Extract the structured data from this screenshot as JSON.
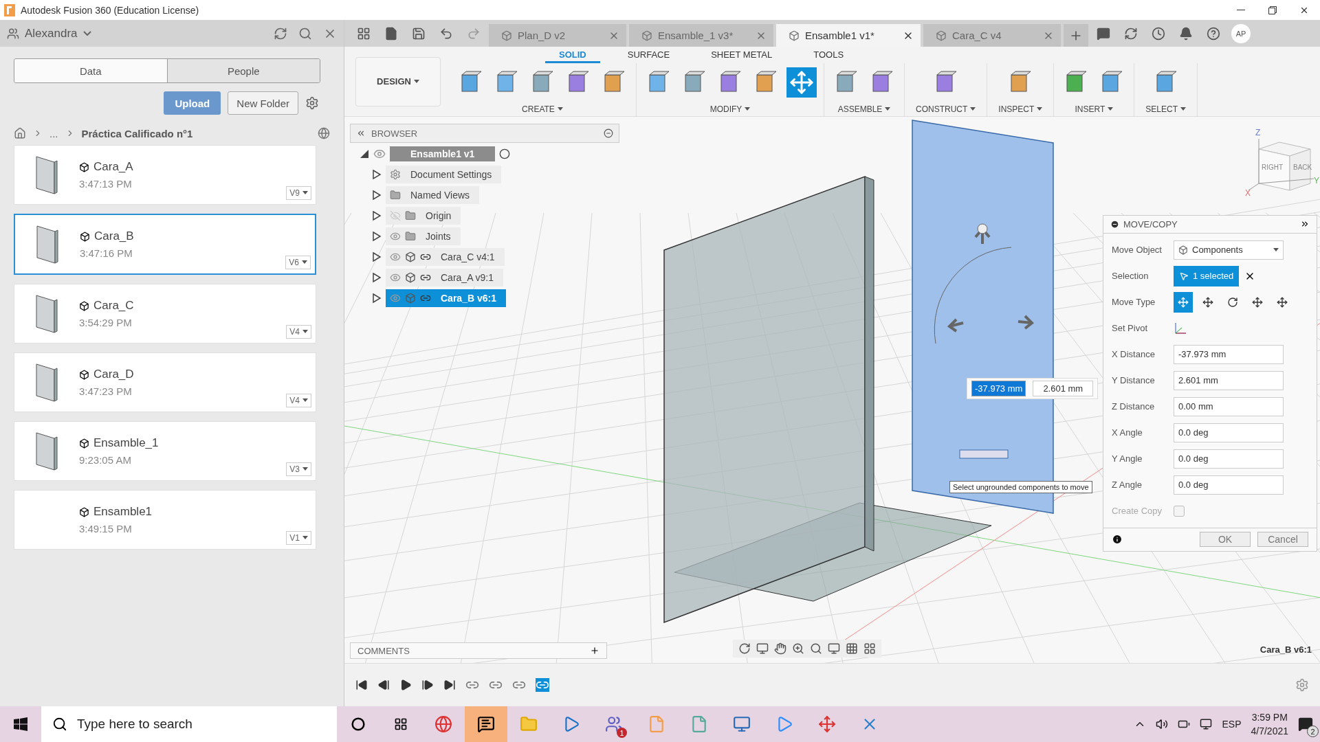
{
  "window": {
    "title": "Autodesk Fusion 360 (Education License)"
  },
  "data_panel": {
    "user": "Alexandra",
    "tabs": [
      {
        "label": "Data",
        "selected": true
      },
      {
        "label": "People",
        "selected": false
      }
    ],
    "upload": "Upload",
    "new_folder": "New Folder",
    "breadcrumb": [
      "...",
      "Práctica Calificado n°1"
    ],
    "files": [
      {
        "name": "Cara_A",
        "time": "3:47:13 PM",
        "version": "V9",
        "selected": false,
        "has_thumbnail": true
      },
      {
        "name": "Cara_B",
        "time": "3:47:16 PM",
        "version": "V6",
        "selected": true,
        "has_thumbnail": true
      },
      {
        "name": "Cara_C",
        "time": "3:54:29 PM",
        "version": "V4",
        "selected": false,
        "has_thumbnail": true
      },
      {
        "name": "Cara_D",
        "time": "3:47:23 PM",
        "version": "V4",
        "selected": false,
        "has_thumbnail": true
      },
      {
        "name": "Ensamble_1",
        "time": "9:23:05 AM",
        "version": "V3",
        "selected": false,
        "has_thumbnail": true
      },
      {
        "name": "Ensamble1",
        "time": "3:49:15 PM",
        "version": "V1",
        "selected": false,
        "has_thumbnail": false
      }
    ]
  },
  "doc_tabs": [
    {
      "label": "Plan_D v2",
      "selected": false
    },
    {
      "label": "Ensamble_1 v3*",
      "selected": false
    },
    {
      "label": "Ensamble1 v1*",
      "selected": true
    },
    {
      "label": "Cara_C v4",
      "selected": false
    }
  ],
  "user_initials": "AP",
  "ribbon": {
    "workspace": "DESIGN",
    "tabs": [
      {
        "label": "SOLID",
        "selected": true
      },
      {
        "label": "SURFACE",
        "selected": false
      },
      {
        "label": "SHEET METAL",
        "selected": false
      },
      {
        "label": "TOOLS",
        "selected": false
      }
    ],
    "groups": [
      {
        "label": "CREATE",
        "tools": [
          {
            "active": false
          },
          {
            "active": false
          },
          {
            "active": false
          },
          {
            "active": false
          },
          {
            "active": false
          }
        ]
      },
      {
        "label": "MODIFY",
        "tools": [
          {
            "active": false
          },
          {
            "active": false
          },
          {
            "active": false
          },
          {
            "active": false
          },
          {
            "active": true
          }
        ]
      },
      {
        "label": "ASSEMBLE",
        "tools": [
          {
            "active": false
          },
          {
            "active": false
          }
        ]
      },
      {
        "label": "CONSTRUCT",
        "tools": [
          {
            "active": false
          }
        ]
      },
      {
        "label": "INSPECT",
        "tools": [
          {
            "active": false
          }
        ]
      },
      {
        "label": "INSERT",
        "tools": [
          {
            "active": false
          },
          {
            "active": false
          }
        ]
      },
      {
        "label": "SELECT",
        "tools": [
          {
            "active": false
          }
        ]
      }
    ]
  },
  "browser": {
    "title": "BROWSER",
    "root": {
      "label": "Ensamble1 v1",
      "expanded": true,
      "children": [
        {
          "label": "Document Settings",
          "kind": "settings",
          "expanded": false,
          "selected": false
        },
        {
          "label": "Named Views",
          "kind": "folder",
          "expanded": false,
          "selected": false
        },
        {
          "label": "Origin",
          "kind": "folder",
          "visible": false,
          "expanded": false,
          "selected": false
        },
        {
          "label": "Joints",
          "kind": "folder",
          "visible": true,
          "expanded": false,
          "selected": false
        },
        {
          "label": "Cara_C v4:1",
          "kind": "component",
          "visible": true,
          "expanded": false,
          "selected": false
        },
        {
          "label": "Cara_A v9:1",
          "kind": "component",
          "visible": true,
          "expanded": false,
          "selected": false
        },
        {
          "label": "Cara_B v6:1",
          "kind": "component",
          "visible": true,
          "expanded": false,
          "selected": true
        }
      ]
    }
  },
  "view_cube": {
    "faces": [
      "RIGHT",
      "BACK"
    ],
    "axes": [
      "Z",
      "X",
      "Y"
    ]
  },
  "move_copy": {
    "title": "MOVE/COPY",
    "rows": [
      {
        "kind": "dropdown",
        "label": "Move Object",
        "value": "Components"
      },
      {
        "kind": "selection",
        "label": "Selection",
        "value": "1 selected"
      },
      {
        "kind": "types",
        "label": "Move Type",
        "options": [
          {
            "selected": true
          },
          {
            "selected": false
          },
          {
            "selected": false
          },
          {
            "selected": false
          },
          {
            "selected": false
          }
        ]
      },
      {
        "kind": "pivot",
        "label": "Set Pivot"
      },
      {
        "kind": "field",
        "label": "X Distance",
        "value": "-37.973 mm"
      },
      {
        "kind": "field",
        "label": "Y Distance",
        "value": "2.601 mm"
      },
      {
        "kind": "field",
        "label": "Z Distance",
        "value": "0.00 mm"
      },
      {
        "kind": "field",
        "label": "X Angle",
        "value": "0.0 deg"
      },
      {
        "kind": "field",
        "label": "Y Angle",
        "value": "0.0 deg"
      },
      {
        "kind": "field",
        "label": "Z Angle",
        "value": "0.0 deg"
      },
      {
        "kind": "checkbox",
        "label": "Create Copy",
        "checked": false,
        "disabled": true
      }
    ],
    "ok": "OK",
    "cancel": "Cancel"
  },
  "inline_edit": [
    "-37.973 mm",
    "2.601 mm"
  ],
  "tooltip": "Select ungrounded components to move",
  "comments": "COMMENTS",
  "status": "Cara_B v6:1",
  "taskbar": {
    "search_placeholder": "Type here to search",
    "teams_badge": "1",
    "language": "ESP",
    "time": "3:59 PM",
    "date": "4/7/2021",
    "notifications": "2"
  }
}
